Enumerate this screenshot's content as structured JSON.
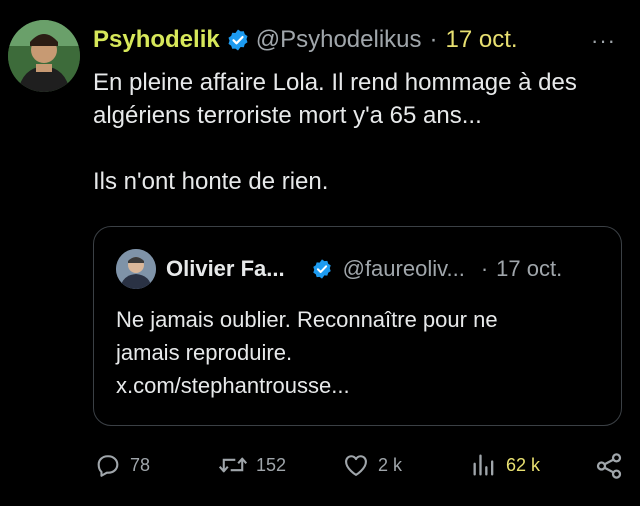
{
  "tweet": {
    "author_name": "Psyhodelik",
    "author_handle": "@Psyhodelikus",
    "separator": "·",
    "date": "17 oct.",
    "more": "···",
    "text_line1": "En pleine affaire Lola. Il rend hommage à des algériens terroriste mort y'a 65 ans...",
    "text_line2": "Ils n'ont honte de rien."
  },
  "quoted": {
    "author_name": "Olivier Fa...",
    "author_handle": "@faureoliv...",
    "separator": "·",
    "date": "17 oct.",
    "lines": [
      "Ne jamais oublier. Reconnaître pour ne",
      "jamais reproduire.",
      "x.com/stephantrousse..."
    ]
  },
  "actions": {
    "replies": "78",
    "reposts": "152",
    "likes": "2 k",
    "views": "62 k"
  },
  "colors": {
    "accent_name": "#d7e85a",
    "accent_date": "#e8e071",
    "verified": "#1d9bf0",
    "muted": "#a0a6ab"
  },
  "icons": [
    "verified-icon",
    "more-icon",
    "reply-icon",
    "repost-icon",
    "like-icon",
    "views-icon",
    "share-icon"
  ]
}
